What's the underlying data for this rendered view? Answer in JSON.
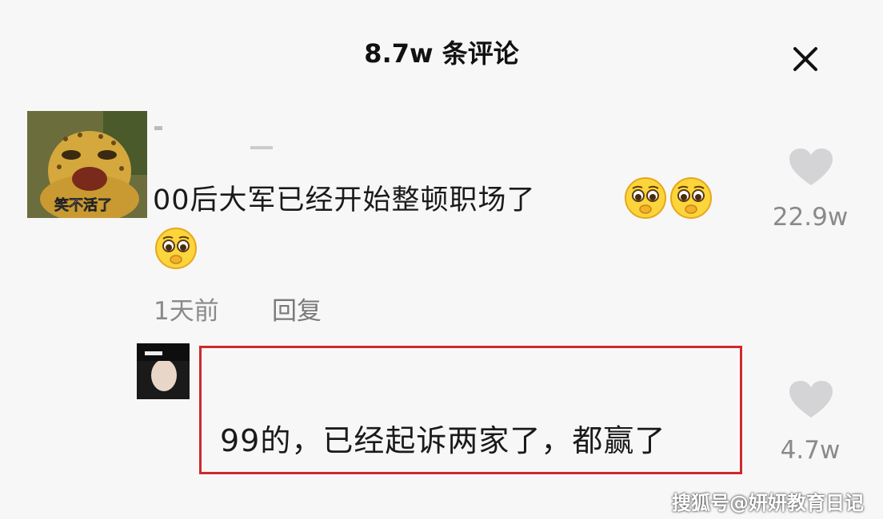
{
  "header": {
    "title": "8.7w 条评论",
    "close_icon": "close-icon"
  },
  "comments": [
    {
      "avatar_caption": "笑不活了",
      "text": "00后大军已经开始整顿职场了",
      "emojis": [
        "pleading-face-icon",
        "pleading-face-icon",
        "pleading-face-icon"
      ],
      "time": "1天前",
      "reply_label": "回复",
      "likes": "22.9w"
    },
    {
      "text": "99的，已经起诉两家了，都赢了",
      "likes": "4.7w",
      "highlighted": true,
      "highlight_color": "#d0282b"
    }
  ],
  "watermark": "搜狐号@妍妍教育日记"
}
